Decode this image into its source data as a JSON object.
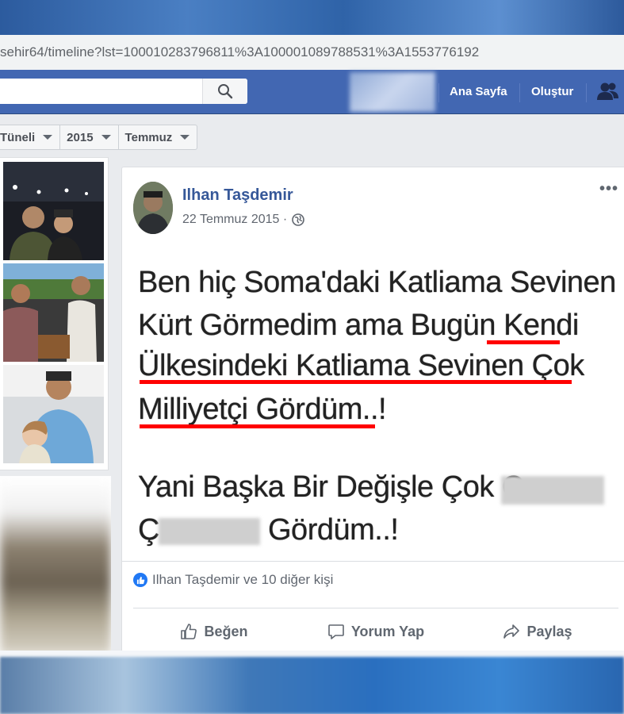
{
  "browser": {
    "url": "sehir64/timeline?lst=100010283796811%3A100001089788531%3A1553776192"
  },
  "header": {
    "nav_home": "Ana Sayfa",
    "nav_create": "Oluştur",
    "brand_color": "#4267b2"
  },
  "timeline_filter": {
    "item1": "Tüneli",
    "item2": "2015",
    "item3": "Temmuz"
  },
  "post": {
    "author": "Ilhan Taşdemir",
    "date": "22 Temmuz 2015 ·",
    "image_text": {
      "line1": "Ben hiç Soma'daki Katliama Sevinen",
      "line2": "Kürt Görmedim ama Bugün Kendi",
      "line3": "Ülkesindeki Katliama Sevinen  Çok",
      "line4": "Milliyetçi Gördüm..!",
      "line5": "Yani Başka Bir Değişle Çok O",
      "line6_end": "Gördüm..!",
      "line6_start": "Ç"
    },
    "reactions_text": "Ilhan Taşdemir ve 10 diğer kişi",
    "actions": {
      "like": "Beğen",
      "comment": "Yorum Yap",
      "share": "Paylaş"
    }
  }
}
